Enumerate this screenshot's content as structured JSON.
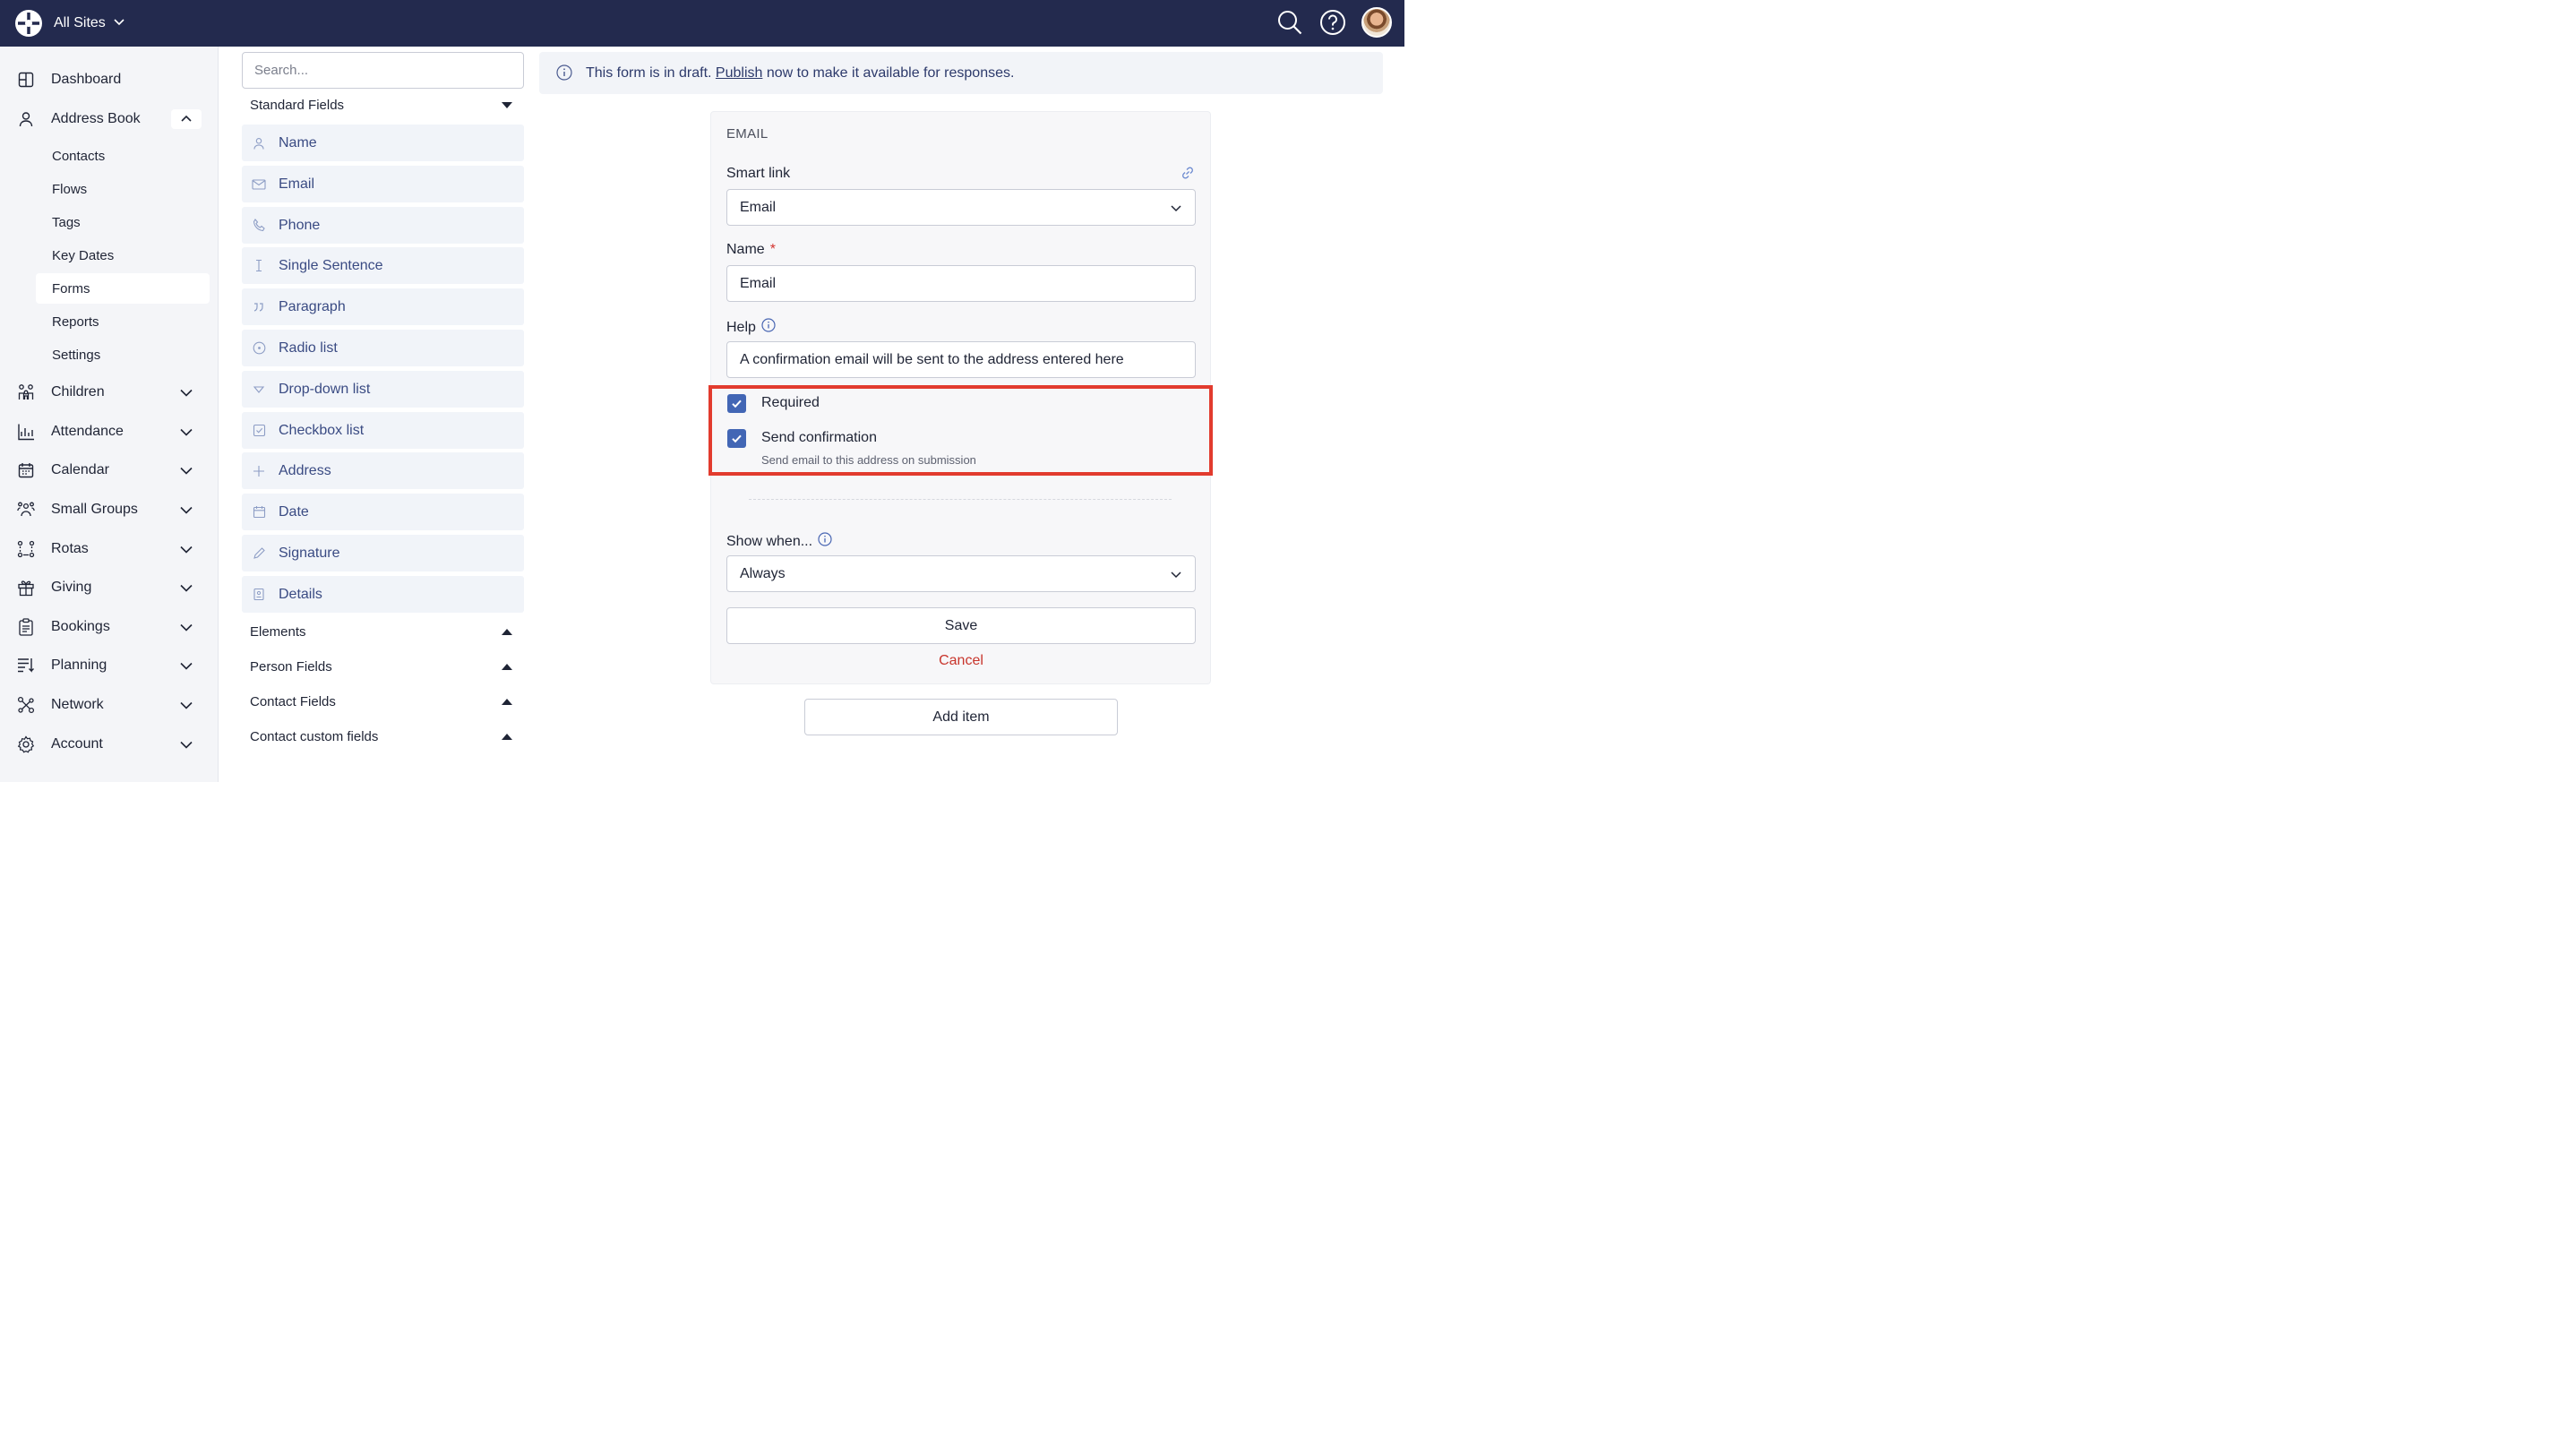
{
  "topbar": {
    "site_switcher": "All Sites",
    "icons": [
      "app-logo-icon",
      "search-icon",
      "help-icon",
      "user-avatar"
    ]
  },
  "sidebar": {
    "items": [
      {
        "label": "Dashboard",
        "icon": "dashboard-icon"
      },
      {
        "label": "Address Book",
        "icon": "person-icon",
        "expanded": true
      },
      {
        "label": "Children",
        "icon": "children-icon"
      },
      {
        "label": "Attendance",
        "icon": "chart-icon"
      },
      {
        "label": "Calendar",
        "icon": "calendar-icon"
      },
      {
        "label": "Small Groups",
        "icon": "groups-icon"
      },
      {
        "label": "Rotas",
        "icon": "rotas-icon"
      },
      {
        "label": "Giving",
        "icon": "gift-icon"
      },
      {
        "label": "Bookings",
        "icon": "clipboard-icon"
      },
      {
        "label": "Planning",
        "icon": "planning-icon"
      },
      {
        "label": "Network",
        "icon": "network-icon"
      },
      {
        "label": "Account",
        "icon": "gear-icon"
      }
    ],
    "address_book_sub": [
      "Contacts",
      "Flows",
      "Tags",
      "Key Dates",
      "Forms",
      "Reports",
      "Settings"
    ],
    "active_sub": "Forms"
  },
  "palette": {
    "search_placeholder": "Search...",
    "standard_fields_label": "Standard Fields",
    "fields": [
      "Name",
      "Email",
      "Phone",
      "Single Sentence",
      "Paragraph",
      "Radio list",
      "Drop-down list",
      "Checkbox list",
      "Address",
      "Date",
      "Signature",
      "Details"
    ],
    "groups": [
      "Elements",
      "Person Fields",
      "Contact Fields",
      "Contact custom fields"
    ]
  },
  "banner": {
    "before": "This form is in draft. ",
    "link": "Publish",
    "after": " now to make it available for responses."
  },
  "editor": {
    "section_title": "EMAIL",
    "smart_link_label": "Smart link",
    "smart_link_value": "Email",
    "name_label": "Name",
    "name_required_mark": "*",
    "name_value": "Email",
    "help_label": "Help",
    "help_value": "A confirmation email will be sent to the address entered here",
    "required_label": "Required",
    "required_checked": true,
    "send_confirmation_label": "Send confirmation",
    "send_confirmation_checked": true,
    "send_confirmation_help": "Send email to this address on submission",
    "show_when_label": "Show when...",
    "show_when_value": "Always",
    "save_label": "Save",
    "cancel_label": "Cancel"
  },
  "add_item_label": "Add item",
  "colors": {
    "topbar": "#232a4e",
    "accent": "#4266b5",
    "field_text": "#3a4b83",
    "highlight": "#e23b2e",
    "cancel": "#c8352c"
  }
}
